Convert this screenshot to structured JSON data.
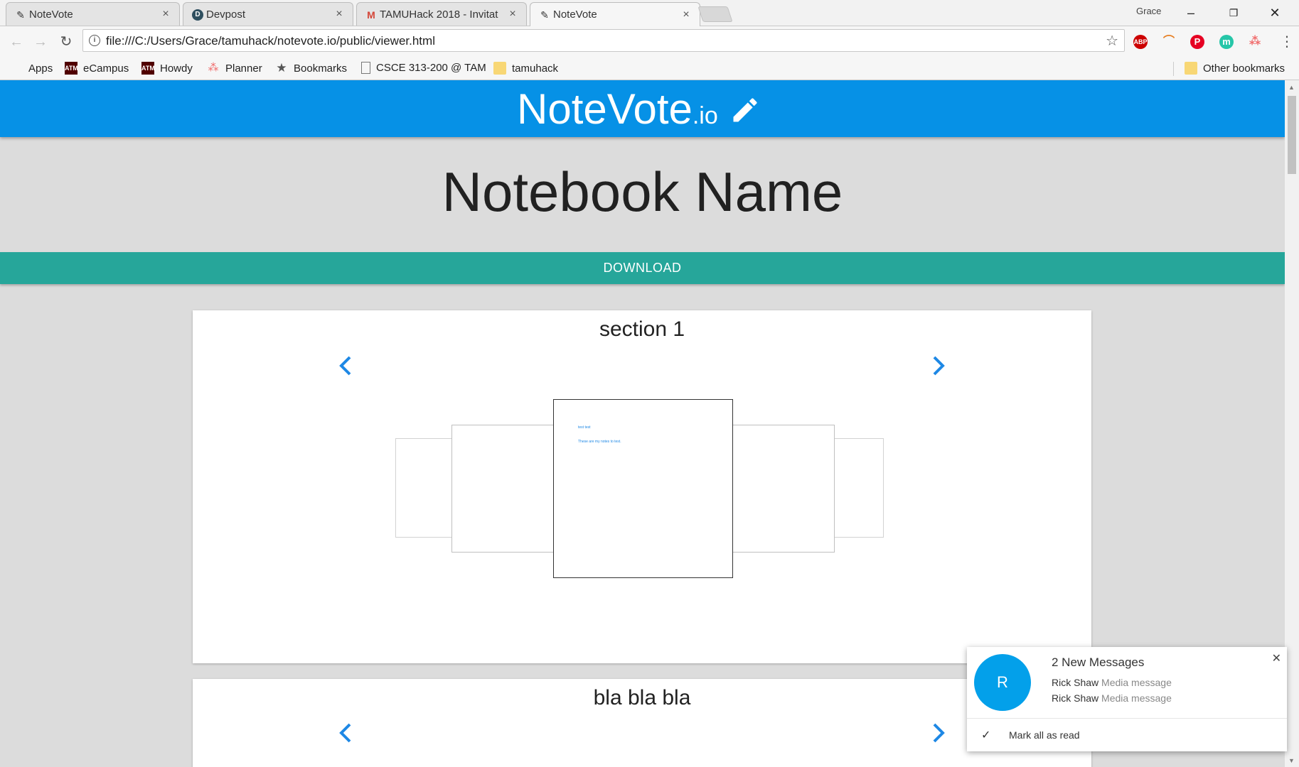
{
  "browser": {
    "tabs": [
      {
        "title": "NoteVote",
        "favicon": "pencil-icon"
      },
      {
        "title": "Devpost",
        "favicon": "devpost-icon"
      },
      {
        "title": "TAMUHack 2018 - Invitat",
        "favicon": "gmail-icon"
      },
      {
        "title": "NoteVote",
        "favicon": "pencil-icon"
      }
    ],
    "profile_name": "Grace",
    "url": "file:///C:/Users/Grace/tamuhack/notevote.io/public/viewer.html",
    "extensions": [
      "ABP",
      "rainbow",
      "pinterest",
      "m",
      "asana"
    ],
    "bookmarks": [
      {
        "label": "Apps",
        "icon": "apps-grid-icon"
      },
      {
        "label": "eCampus",
        "icon": "atm-icon"
      },
      {
        "label": "Howdy",
        "icon": "atm-icon"
      },
      {
        "label": "Planner",
        "icon": "asana-icon"
      },
      {
        "label": "Bookmarks",
        "icon": "star-icon"
      },
      {
        "label": "CSCE 313-200 @ TAM",
        "icon": "page-icon"
      },
      {
        "label": "tamuhack",
        "icon": "folder-icon"
      }
    ],
    "other_bookmarks": "Other bookmarks"
  },
  "app": {
    "logo_main": "NoteVote",
    "logo_tld": ".io",
    "header_color": "#0691e6",
    "notebook_name": "Notebook Name",
    "download_label": "DOWNLOAD",
    "download_color": "#26a69a",
    "sections": [
      {
        "title": "section 1",
        "center_page": {
          "line1": "test test",
          "line2": "These are my notes to test."
        }
      },
      {
        "title": "bla bla bla"
      }
    ]
  },
  "notification": {
    "avatar_letter": "R",
    "title": "2 New Messages",
    "messages": [
      {
        "sender": "Rick Shaw",
        "text": "Media message"
      },
      {
        "sender": "Rick Shaw",
        "text": "Media message"
      }
    ],
    "mark_all": "Mark all as read"
  }
}
